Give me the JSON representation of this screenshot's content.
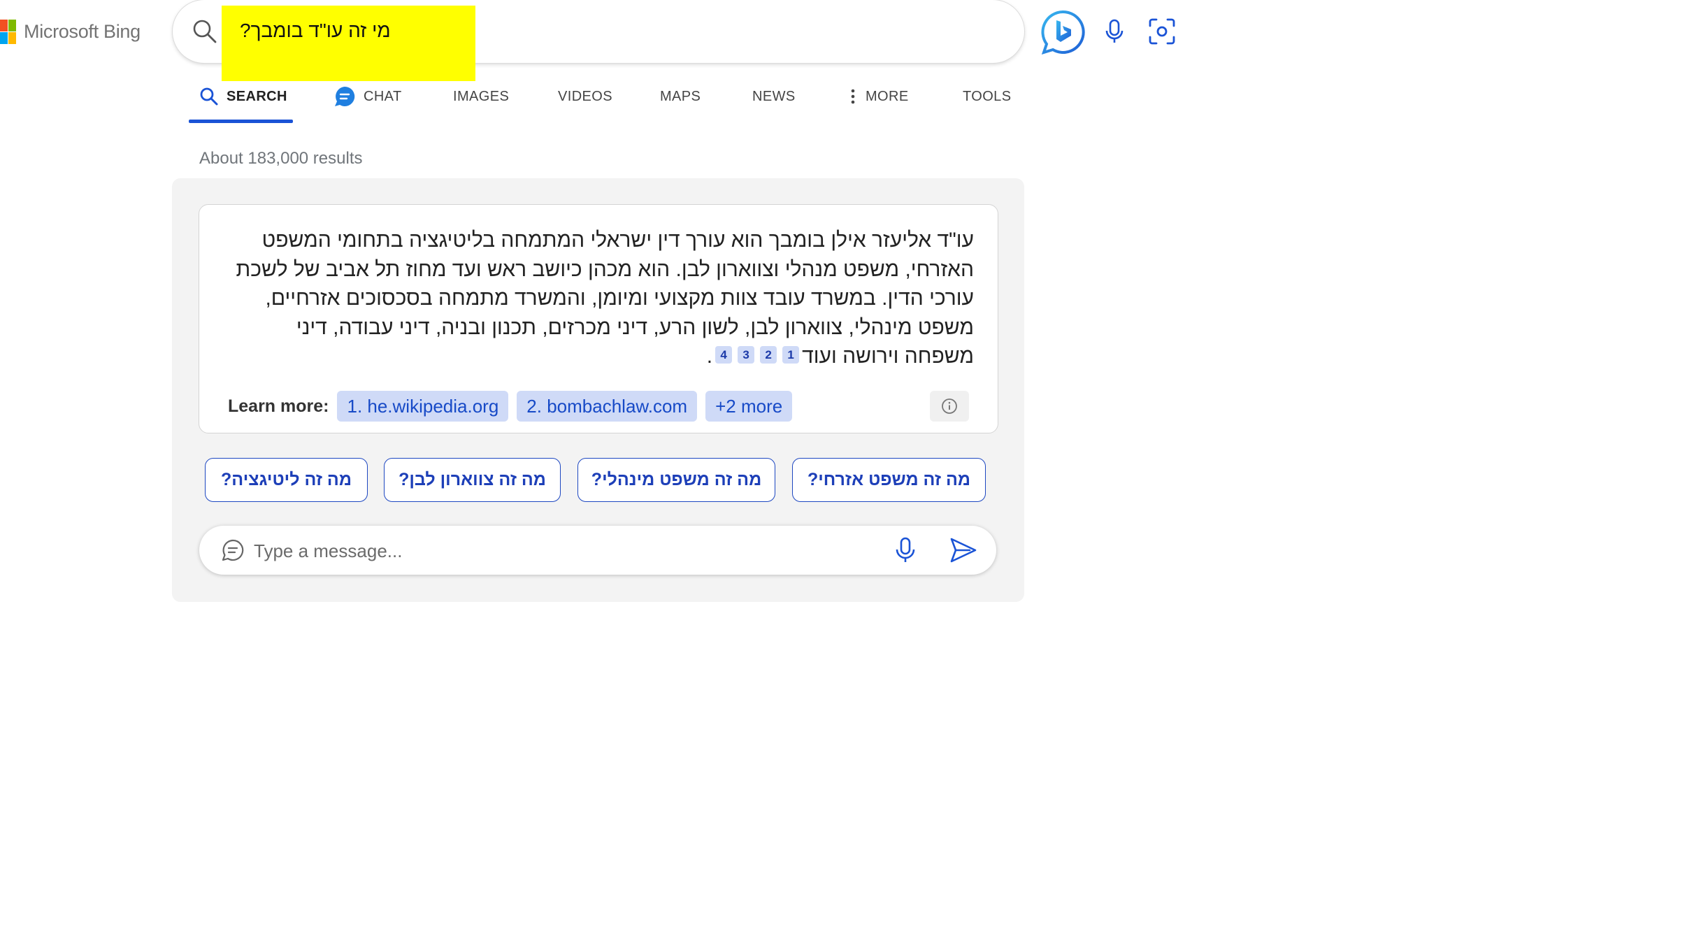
{
  "brand": {
    "name": "Microsoft Bing",
    "colors": [
      "#f25022",
      "#7fba00",
      "#00a4ef",
      "#ffb900"
    ]
  },
  "search": {
    "query": "מי זה עו\"ד בומבך?",
    "highlight_color": "#ffff00"
  },
  "nav": {
    "search": "SEARCH",
    "chat": "CHAT",
    "images": "IMAGES",
    "videos": "VIDEOS",
    "maps": "MAPS",
    "news": "NEWS",
    "more": "MORE",
    "tools": "TOOLS"
  },
  "results": {
    "count_text": "About 183,000 results"
  },
  "answer": {
    "text": "עו\"ד אליעזר אילן בומבך הוא עורך דין ישראלי המתמחה בליטיגציה בתחומי המשפט האזרחי, משפט מנהלי וצווארון לבן. הוא מכהן כיושב ראש ועד מחוז תל אביב של לשכת עורכי הדין. במשרד עובד צוות מקצועי ומיומן, והמשרד מתמחה בסכסוכים אזרחיים, משפט מינהלי, צווארון לבן, לשון הרע, דיני מכרזים, תכנון ובניה, דיני עבודה, דיני משפחה וירושה ועוד",
    "citations": [
      "1",
      "2",
      "3",
      "4"
    ],
    "end_punct": ".",
    "learn_more_label": "Learn more:",
    "sources": [
      "1. he.wikipedia.org",
      "2. bombachlaw.com",
      "+2 more"
    ]
  },
  "suggestions": [
    "מה זה משפט אזרחי?",
    "מה זה משפט מינהלי?",
    "מה זה צווארון לבן?",
    "מה זה ליטיגציה?"
  ],
  "composer": {
    "placeholder": "Type a message..."
  },
  "accent": "#1a53d6"
}
